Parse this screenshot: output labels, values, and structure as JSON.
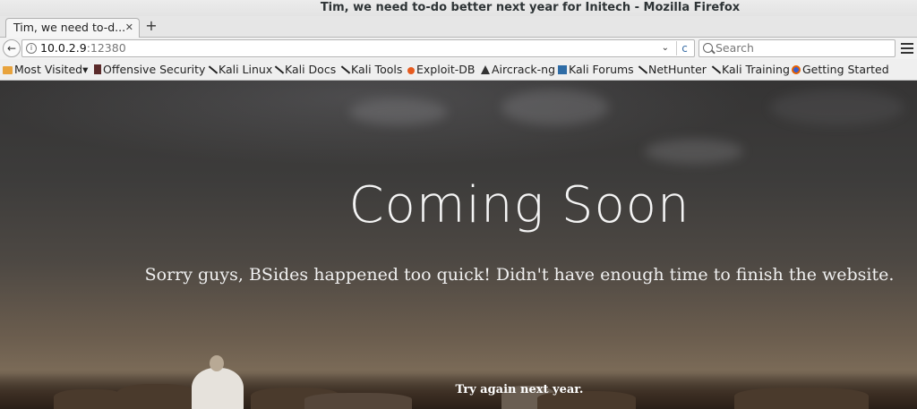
{
  "window": {
    "title": "Tim, we need to-do better next year for Initech - Mozilla Firefox"
  },
  "tabs": [
    {
      "label": "Tim, we need to-d...",
      "close": "✕"
    }
  ],
  "new_tab": "+",
  "navbar": {
    "back": "←",
    "url_host": "10.0.2.9",
    "url_port": ":12380",
    "search_placeholder": "Search",
    "reload": "c"
  },
  "bookmarks": [
    {
      "label": "Most Visited",
      "icon": "folder-icon",
      "dropdown": "▾"
    },
    {
      "label": "Offensive Security",
      "icon": "offsec-icon"
    },
    {
      "label": "Kali Linux",
      "icon": "kali-dragon-icon"
    },
    {
      "label": "Kali Docs",
      "icon": "kali-dragon-icon"
    },
    {
      "label": "Kali Tools",
      "icon": "kali-dragon-icon"
    },
    {
      "label": "Exploit-DB",
      "icon": "exploit-db-icon"
    },
    {
      "label": "Aircrack-ng",
      "icon": "aircrack-icon"
    },
    {
      "label": "Kali Forums",
      "icon": "forums-icon"
    },
    {
      "label": "NetHunter",
      "icon": "kali-dragon-icon"
    },
    {
      "label": "Kali Training",
      "icon": "kali-dragon-icon"
    },
    {
      "label": "Getting Started",
      "icon": "firefox-icon"
    }
  ],
  "page": {
    "heading": "Coming Soon",
    "subtext": "Sorry guys, BSides happened too quick! Didn't have enough time to finish the website.",
    "footer": "Try again next year."
  }
}
